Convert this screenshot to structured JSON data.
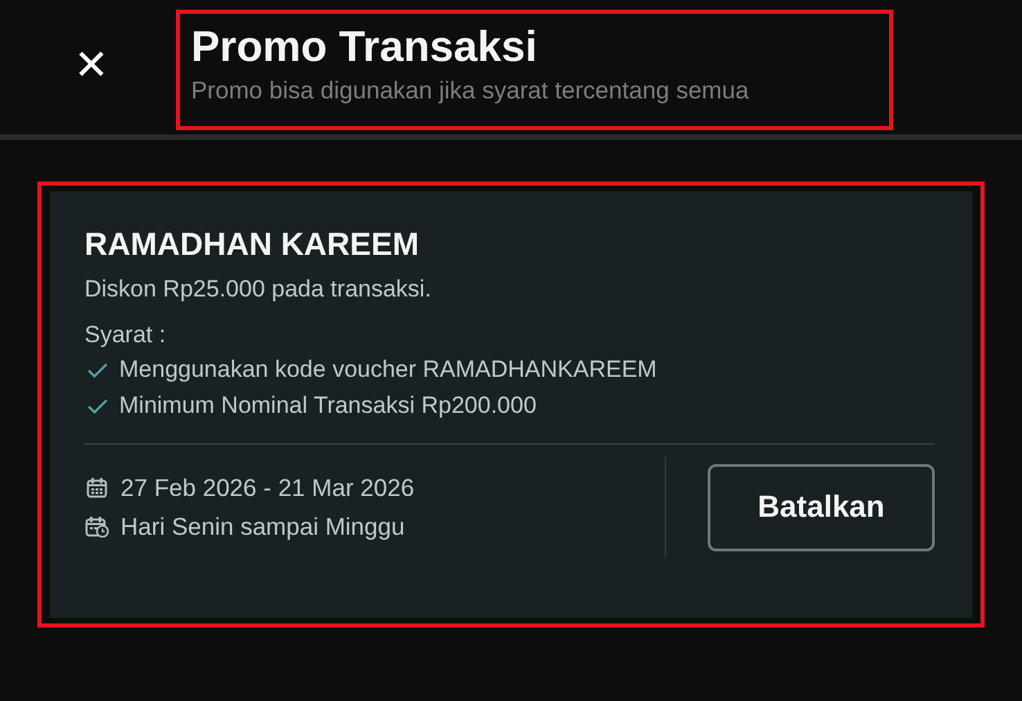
{
  "header": {
    "close_icon": "✕",
    "title": "Promo Transaksi",
    "subtitle": "Promo bisa digunakan jika syarat tercentang semua",
    "highlighted": true
  },
  "promo": {
    "highlighted": true,
    "name": "RAMADHAN KAREEM",
    "description": "Diskon Rp25.000 pada transaksi.",
    "conditions_label": "Syarat :",
    "conditions": [
      {
        "text": "Menggunakan kode voucher RAMADHANKAREEM",
        "checked": true
      },
      {
        "text": "Minimum Nominal Transaksi Rp200.000",
        "checked": true
      }
    ],
    "period": "27 Feb 2026 - 21 Mar 2026",
    "days": "Hari Senin sampai Minggu",
    "button": "Batalkan"
  }
}
